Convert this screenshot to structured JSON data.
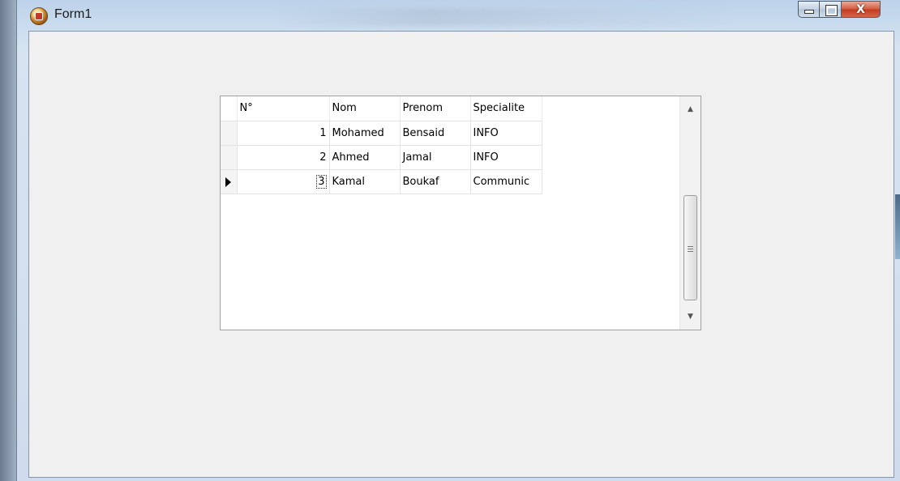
{
  "window": {
    "title": "Form1",
    "controls": {
      "minimize": "",
      "maximize": "",
      "close": "X"
    }
  },
  "grid": {
    "columns": [
      "N°",
      "Nom",
      "Prenom",
      "Specialite"
    ],
    "rows": [
      {
        "no": "1",
        "nom": "Mohamed",
        "prenom": "Bensaid",
        "specialite": "INFO"
      },
      {
        "no": "2",
        "nom": "Ahmed",
        "prenom": "Jamal",
        "specialite": "INFO"
      },
      {
        "no": "3",
        "nom": "Kamal",
        "prenom": "Boukaf",
        "specialite": "Communic"
      }
    ],
    "current_row": 3,
    "scrollbar": {
      "up_arrow": "▲",
      "down_arrow": "▼"
    }
  },
  "icons": [
    "app-icon",
    "row-indicator-icon",
    "scroll-up-icon",
    "scroll-down-icon",
    "scroll-grip-icon"
  ]
}
